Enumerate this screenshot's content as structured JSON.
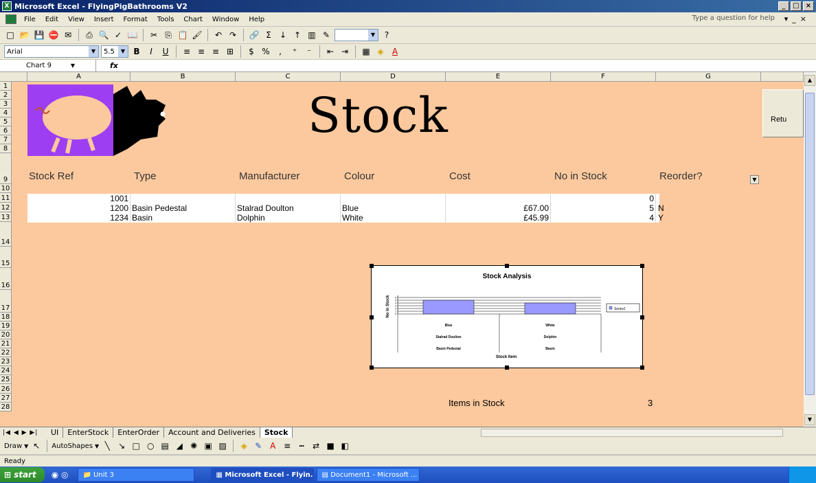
{
  "window": {
    "title": "Microsoft Excel - FlyingPigBathrooms V2"
  },
  "menu": {
    "items": [
      "File",
      "Edit",
      "View",
      "Insert",
      "Format",
      "Tools",
      "Chart",
      "Window",
      "Help"
    ],
    "help_placeholder": "Type a question for help"
  },
  "format": {
    "font": "Arial",
    "size": "5.5"
  },
  "namebox": {
    "value": "Chart 9"
  },
  "columns": [
    "A",
    "B",
    "C",
    "D",
    "E",
    "F",
    "G"
  ],
  "rows": [
    "1",
    "2",
    "3",
    "4",
    "5",
    "6",
    "7",
    "8",
    "9",
    "10",
    "11",
    "12",
    "13",
    "14",
    "15",
    "16",
    "17",
    "18",
    "19",
    "20",
    "21",
    "22",
    "23",
    "24",
    "25",
    "26",
    "27",
    "28"
  ],
  "sheet": {
    "title": "Stock",
    "return_button": "Retu",
    "headers": [
      "Stock Ref",
      "Type",
      "Manufacturer",
      "Colour",
      "Cost",
      "No in Stock",
      "Reorder?"
    ],
    "table": [
      {
        "ref": "1001",
        "type": "",
        "manufacturer": "",
        "colour": "",
        "cost": "",
        "stock": "0",
        "reorder": ""
      },
      {
        "ref": "1200",
        "type": "Basin Pedestal",
        "manufacturer": "Stalrad Doulton",
        "colour": "Blue",
        "cost": "£67.00",
        "stock": "5",
        "reorder": "N"
      },
      {
        "ref": "1234",
        "type": "Basin",
        "manufacturer": "Dolphin",
        "colour": "White",
        "cost": "£45.99",
        "stock": "4",
        "reorder": "Y"
      }
    ],
    "summary_label": "Items in Stock",
    "summary_value": "3"
  },
  "chart_data": {
    "type": "bar",
    "title": "Stock Analysis",
    "ylabel": "No in Stock",
    "xlabel": "Stock Item",
    "categories": [
      [
        "Blue",
        "Stalrad Doulton",
        "Basin Pedestal"
      ],
      [
        "White",
        "Dolphin",
        "Basin"
      ]
    ],
    "series": [
      {
        "name": "Series1",
        "values": [
          5,
          4
        ]
      }
    ],
    "ylim": [
      0,
      6
    ],
    "yticks": [
      "0",
      "1",
      "2",
      "3",
      "4",
      "5",
      "6"
    ],
    "bar_color": "#9999ff",
    "grid": true,
    "legend": "right"
  },
  "sheet_tabs": [
    "UI",
    "EnterStock",
    "EnterOrder",
    "Account and Deliveries",
    "Stock"
  ],
  "active_tab": "Stock",
  "drawbar": {
    "draw": "Draw",
    "autoshapes": "AutoShapes"
  },
  "status": {
    "text": "Ready"
  },
  "taskbar": {
    "start": "start",
    "tasks": [
      "Unit 3",
      "Microsoft Excel - Flyin...",
      "Document1 - Microsoft ..."
    ]
  },
  "colors": {
    "sheet_bg": "#fcc99e",
    "logo_bg": "#9d3ef2",
    "title_bar": "#0a246a"
  }
}
